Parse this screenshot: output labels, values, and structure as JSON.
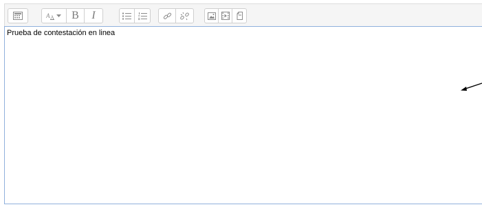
{
  "toolbar": {
    "groups": [
      {
        "buttons": [
          {
            "icon": "show-more-buttons-icon"
          }
        ]
      },
      {
        "buttons": [
          {
            "icon": "font-style-dropdown-icon"
          },
          {
            "label": "B",
            "icon": "bold-icon"
          },
          {
            "label": "I",
            "icon": "italic-icon"
          }
        ]
      },
      {
        "buttons": [
          {
            "icon": "unordered-list-icon"
          },
          {
            "icon": "ordered-list-icon"
          }
        ]
      },
      {
        "buttons": [
          {
            "icon": "link-icon"
          },
          {
            "icon": "unlink-icon"
          }
        ]
      },
      {
        "buttons": [
          {
            "icon": "insert-image-icon"
          },
          {
            "icon": "insert-media-icon"
          },
          {
            "icon": "manage-files-icon"
          }
        ]
      }
    ]
  },
  "editor": {
    "content": "Prueba de contestación en linea"
  },
  "colors": {
    "toolbar_bg": "#f5f5f5",
    "button_border": "#cfcfcf",
    "icon_gray": "#8a8a8a",
    "content_border": "#8fb0dc"
  }
}
